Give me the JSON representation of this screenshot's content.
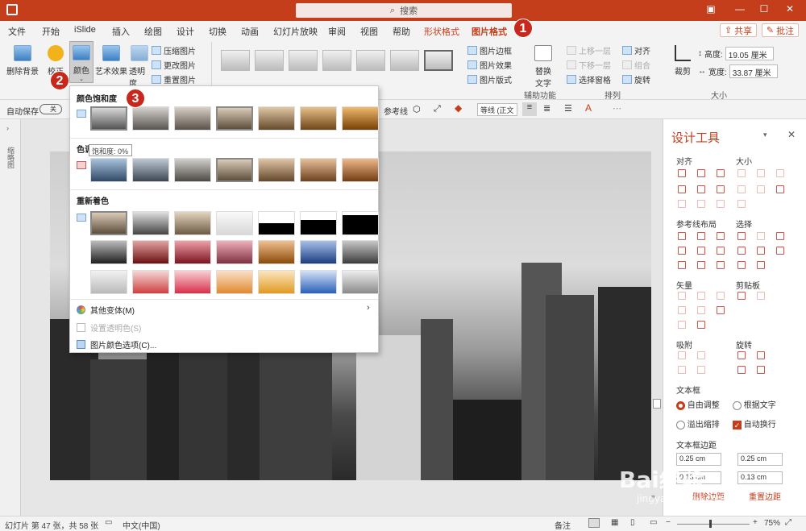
{
  "title_bar": {
    "search_placeholder": "搜索"
  },
  "menu_tabs": [
    "文件",
    "开始",
    "iSlide",
    "插入",
    "绘图",
    "设计",
    "切换",
    "动画",
    "幻灯片放映",
    "审阅",
    "视图",
    "帮助",
    "形状格式",
    "图片格式"
  ],
  "share_label": "共享",
  "comment_label": "批注",
  "ribbon": {
    "remove_bg": "删除背景",
    "correct": "校正",
    "color": "颜色",
    "artistic": "艺术效果",
    "transparency": "透明度",
    "compress": "压缩图片",
    "change": "更改图片",
    "reset": "重置图片",
    "border": "图片边框",
    "effects": "图片效果",
    "layout": "图片版式",
    "alt_text": "替换文字",
    "accessibility_group": "辅助功能",
    "bring_forward": "上移一层",
    "send_backward": "下移一层",
    "selection_pane": "选择窗格",
    "align": "对齐",
    "group": "组合",
    "rotate": "旋转",
    "arrange_group": "排列",
    "crop": "裁剪",
    "height_label": "高度:",
    "height_value": "19.05 厘米",
    "width_label": "宽度:",
    "width_value": "33.87 厘米",
    "size_group": "大小"
  },
  "format_bar": {
    "autosave": "自动保存",
    "autosave_state": "关",
    "guides": "参考线",
    "line_style": "等线 (正文"
  },
  "dropdown": {
    "section_saturation": "颜色饱和度",
    "section_tone": "色调",
    "tooltip": "饱和度: 0%",
    "section_recolor": "重新着色",
    "more_variations": "其他变体(M)",
    "set_transparent": "设置透明色(S)",
    "color_options": "图片颜色选项(C)..."
  },
  "design_pane": {
    "title": "设计工具",
    "align": "对齐",
    "size": "大小",
    "guides_layout": "参考线布局",
    "select": "选择",
    "vector": "矢量",
    "clipboard": "剪贴板",
    "snap": "吸附",
    "rotate": "旋转",
    "textbox": "文本框",
    "auto_adjust": "自由调整",
    "fit_text": "根据文字",
    "overflow": "溢出缩排",
    "auto_wrap": "自动换行",
    "margin_title": "文本框边距",
    "m1": "0.25 cm",
    "m2": "0.25 cm",
    "m3": "0.13 cm",
    "m4": "0.13 cm",
    "delete_margin": "删除边距",
    "reset_margin": "重置边距"
  },
  "thumbnails_label": "缩略图",
  "status": {
    "slide_info": "幻灯片 第 47 张，共 58 张",
    "language": "中文(中国)",
    "notes": "备注",
    "zoom": "75%"
  },
  "badges": [
    "1",
    "2",
    "3"
  ],
  "watermark": {
    "brand": "Bai",
    "brand2": "经验",
    "url": "jingyan.baidu.com"
  },
  "colors": {
    "accent": "#c43e1c",
    "badge": "#c8271c"
  }
}
